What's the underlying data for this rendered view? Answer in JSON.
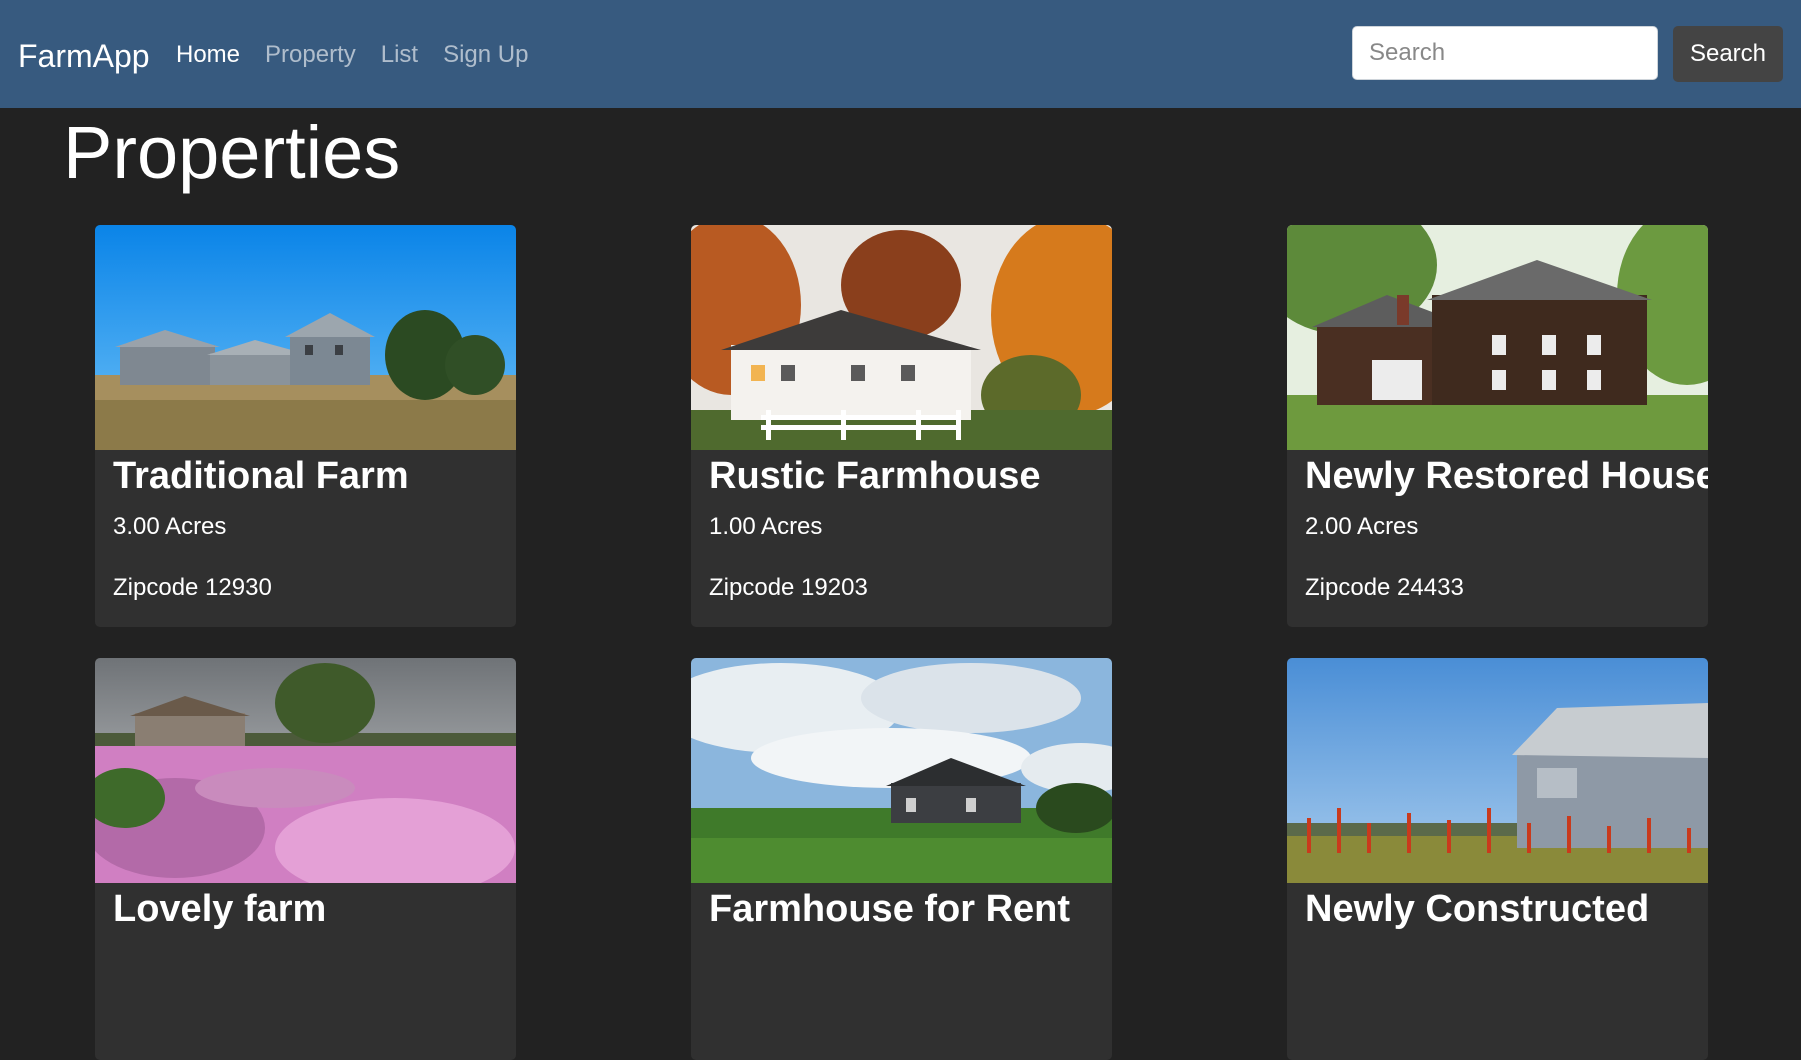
{
  "navbar": {
    "brand": "FarmApp",
    "links": [
      {
        "label": "Home",
        "active": true
      },
      {
        "label": "Property",
        "active": false
      },
      {
        "label": "List",
        "active": false
      },
      {
        "label": "Sign Up",
        "active": false
      }
    ],
    "search": {
      "placeholder": "Search",
      "value": "",
      "button_label": "Search"
    }
  },
  "page": {
    "title": "Properties"
  },
  "properties": [
    {
      "title": "Traditional Farm",
      "acres": "3.00 Acres",
      "zipcode": "Zipcode 12930",
      "image_icon": "farmhouse-field-photo"
    },
    {
      "title": "Rustic Farmhouse",
      "acres": "1.00 Acres",
      "zipcode": "Zipcode 19203",
      "image_icon": "autumn-farmhouse-photo"
    },
    {
      "title": "Newly Restored House",
      "acres": "2.00 Acres",
      "zipcode": "Zipcode 24433",
      "image_icon": "restored-house-photo"
    },
    {
      "title": "Lovely farm",
      "acres": "",
      "zipcode": "",
      "image_icon": "flower-field-farm-photo"
    },
    {
      "title": "Farmhouse for Rent",
      "acres": "",
      "zipcode": "",
      "image_icon": "farmhouse-meadow-photo"
    },
    {
      "title": "Newly Constructed",
      "acres": "",
      "zipcode": "",
      "image_icon": "barn-photo"
    }
  ],
  "colors": {
    "navbar_bg": "#375a7f",
    "page_bg": "#222222",
    "card_bg": "#303030",
    "button_bg": "#444444"
  }
}
